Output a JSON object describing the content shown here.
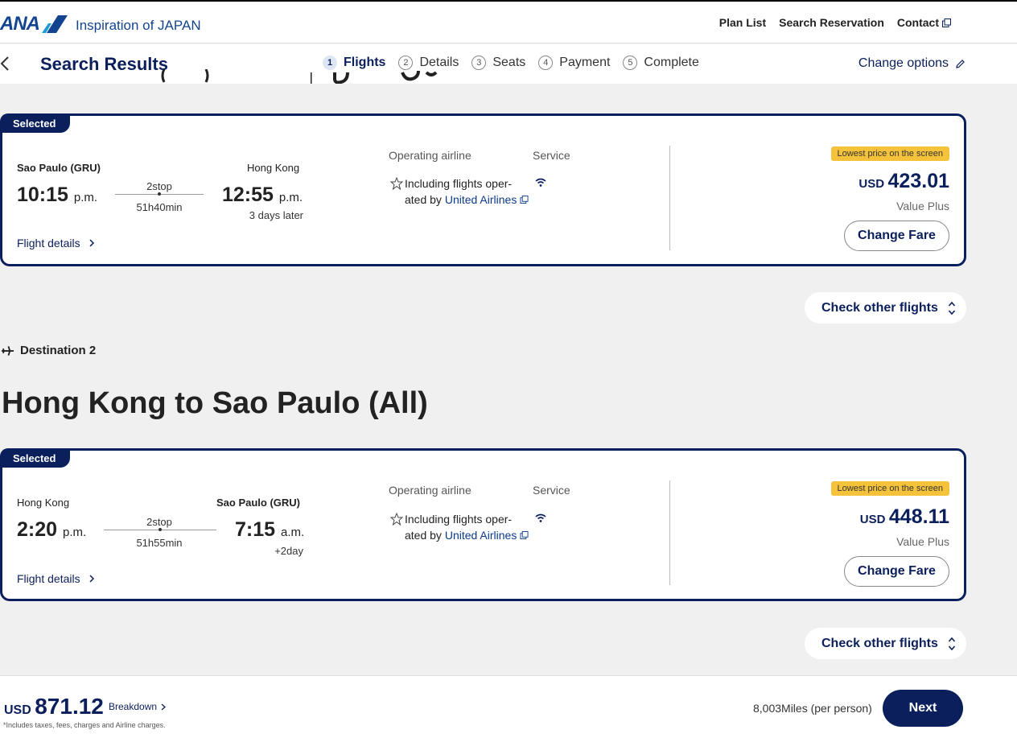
{
  "header": {
    "logo_text": "ANA",
    "tagline": "Inspiration of JAPAN",
    "nav": [
      "Plan List",
      "Search Reservation",
      "Contact"
    ]
  },
  "steps_bar": {
    "title": "Search Results",
    "steps": [
      {
        "num": "1",
        "label": "Flights",
        "active": true
      },
      {
        "num": "2",
        "label": "Details",
        "active": false
      },
      {
        "num": "3",
        "label": "Seats",
        "active": false
      },
      {
        "num": "4",
        "label": "Payment",
        "active": false
      },
      {
        "num": "5",
        "label": "Complete",
        "active": false
      }
    ],
    "change_options": "Change options"
  },
  "flights": [
    {
      "badge": "Selected",
      "dep_city": "Sao Paulo (GRU)",
      "dep_time": "10:15",
      "dep_ampm": "p.m.",
      "stops": "2stop",
      "duration": "51h40min",
      "arr_city": "Hong Kong",
      "arr_time": "12:55",
      "arr_ampm": "p.m.",
      "arr_later": "3 days later",
      "flight_details": "Flight details",
      "operating_airline_label": "Operating airline",
      "service_label": "Service",
      "airline_note_prefix": "Including flights oper-ated by",
      "airline_link": "United Airlines",
      "lowest_label": "Lowest price on the screen",
      "currency": "USD",
      "price": "423.01",
      "fare_name": "Value Plus",
      "change_fare": "Change Fare",
      "check_other": "Check other flights"
    },
    {
      "badge": "Selected",
      "dep_city": "Hong Kong",
      "dep_time": "2:20",
      "dep_ampm": "p.m.",
      "stops": "2stop",
      "duration": "51h55min",
      "arr_city": "Sao Paulo (GRU)",
      "arr_time": "7:15",
      "arr_ampm": "a.m.",
      "arr_later": "+2day",
      "flight_details": "Flight details",
      "operating_airline_label": "Operating airline",
      "service_label": "Service",
      "airline_note_prefix": "Including flights oper-ated by",
      "airline_link": "United Airlines",
      "lowest_label": "Lowest price on the screen",
      "currency": "USD",
      "price": "448.11",
      "fare_name": "Value Plus",
      "change_fare": "Change Fare",
      "check_other": "Check other flights"
    }
  ],
  "destination2": {
    "label": "Destination 2",
    "route_title": "Hong Kong to Sao Paulo (All)"
  },
  "footer": {
    "currency": "USD",
    "total": "871.12",
    "breakdown": "Breakdown",
    "footnote": "*Includes taxes, fees, charges and Airline charges.",
    "miles": "8,003Miles (per person)",
    "next": "Next"
  },
  "colors": {
    "navy": "#0b1f5c",
    "ana_blue": "#13448f",
    "badge_yellow": "#f5c33b",
    "background": "#f0f0f0"
  },
  "icons": [
    "back-chevron-icon",
    "external-link-icon",
    "pencil-icon",
    "star-icon",
    "wifi-icon",
    "chevron-right-icon",
    "sort-arrows-icon",
    "plane-icon"
  ]
}
